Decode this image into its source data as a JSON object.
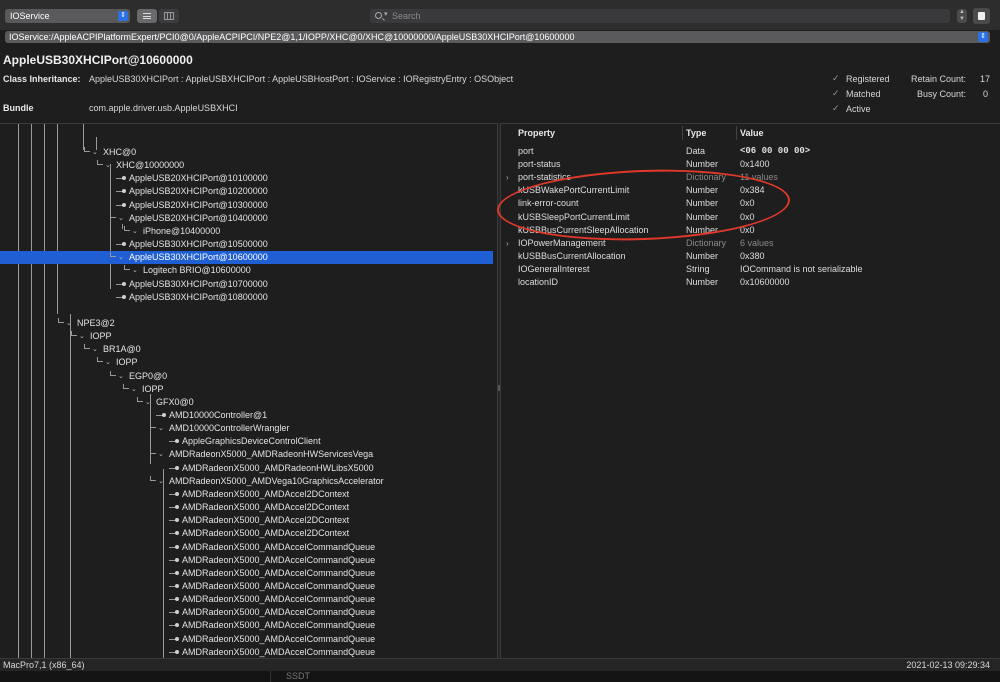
{
  "toolbar": {
    "plane": "IOService",
    "search_placeholder": "Search"
  },
  "path": "IOService:/AppleACPIPlatformExpert/PCI0@0/AppleACPIPCI/NPE2@1,1/IOPP/XHC@0/XHC@10000000/AppleUSB30XHCIPort@10600000",
  "header": {
    "title": "AppleUSB30XHCIPort@10600000",
    "class_label": "Class Inheritance:",
    "class_value": "AppleUSB30XHCIPort : AppleUSBXHCIPort : AppleUSBHostPort : IOService : IORegistryEntry : OSObject",
    "bundle_label": "Bundle",
    "bundle_value": "com.apple.driver.usb.AppleUSBXHCI",
    "flags": [
      "Registered",
      "Matched",
      "Active"
    ],
    "retain_label": "Retain Count:",
    "retain_value": "17",
    "busy_label": "Busy Count:",
    "busy_value": "0"
  },
  "tree": [
    {
      "label": "XHC@0",
      "selected": false
    },
    {
      "label": "XHC@10000000",
      "selected": false
    },
    {
      "label": "AppleUSB20XHCIPort@10100000",
      "selected": false
    },
    {
      "label": "AppleUSB20XHCIPort@10200000",
      "selected": false
    },
    {
      "label": "AppleUSB20XHCIPort@10300000",
      "selected": false
    },
    {
      "label": "AppleUSB20XHCIPort@10400000",
      "selected": false
    },
    {
      "label": "iPhone@10400000",
      "selected": false
    },
    {
      "label": "AppleUSB30XHCIPort@10500000",
      "selected": false
    },
    {
      "label": "AppleUSB30XHCIPort@10600000",
      "selected": true
    },
    {
      "label": "Logitech BRIO@10600000",
      "selected": false
    },
    {
      "label": "AppleUSB30XHCIPort@10700000",
      "selected": false
    },
    {
      "label": "AppleUSB30XHCIPort@10800000",
      "selected": false
    },
    {
      "label": "",
      "selected": false
    },
    {
      "label": "NPE3@2",
      "selected": false
    },
    {
      "label": "IOPP",
      "selected": false
    },
    {
      "label": "BR1A@0",
      "selected": false
    },
    {
      "label": "IOPP",
      "selected": false
    },
    {
      "label": "EGP0@0",
      "selected": false
    },
    {
      "label": "IOPP",
      "selected": false
    },
    {
      "label": "GFX0@0",
      "selected": false
    },
    {
      "label": "AMD10000Controller@1",
      "selected": false
    },
    {
      "label": "AMD10000ControllerWrangler",
      "selected": false
    },
    {
      "label": "AppleGraphicsDeviceControlClient",
      "selected": false
    },
    {
      "label": "AMDRadeonX5000_AMDRadeonHWServicesVega",
      "selected": false
    },
    {
      "label": "AMDRadeonX5000_AMDRadeonHWLibsX5000",
      "selected": false
    },
    {
      "label": "AMDRadeonX5000_AMDVega10GraphicsAccelerator",
      "selected": false
    },
    {
      "label": "AMDRadeonX5000_AMDAccel2DContext",
      "selected": false
    },
    {
      "label": "AMDRadeonX5000_AMDAccel2DContext",
      "selected": false
    },
    {
      "label": "AMDRadeonX5000_AMDAccel2DContext",
      "selected": false
    },
    {
      "label": "AMDRadeonX5000_AMDAccel2DContext",
      "selected": false
    },
    {
      "label": "AMDRadeonX5000_AMDAccelCommandQueue",
      "selected": false
    },
    {
      "label": "AMDRadeonX5000_AMDAccelCommandQueue",
      "selected": false
    },
    {
      "label": "AMDRadeonX5000_AMDAccelCommandQueue",
      "selected": false
    },
    {
      "label": "AMDRadeonX5000_AMDAccelCommandQueue",
      "selected": false
    },
    {
      "label": "AMDRadeonX5000_AMDAccelCommandQueue",
      "selected": false
    },
    {
      "label": "AMDRadeonX5000_AMDAccelCommandQueue",
      "selected": false
    },
    {
      "label": "AMDRadeonX5000_AMDAccelCommandQueue",
      "selected": false
    },
    {
      "label": "AMDRadeonX5000_AMDAccelCommandQueue",
      "selected": false
    },
    {
      "label": "AMDRadeonX5000_AMDAccelCommandQueue",
      "selected": false
    },
    {
      "label": "AMDRadeonX5000_AMDAccelDevice",
      "selected": false
    }
  ],
  "props": {
    "headers": [
      "Property",
      "Type",
      "Value"
    ],
    "rows": [
      {
        "name": "port",
        "type": "Data",
        "value": "<06 00 00 00>",
        "mono": true,
        "expandable": false,
        "dim": false
      },
      {
        "name": "port-status",
        "type": "Number",
        "value": "0x1400",
        "mono": false,
        "expandable": false,
        "dim": false
      },
      {
        "name": "port-statistics",
        "type": "Dictionary",
        "value": "11 values",
        "mono": false,
        "expandable": true,
        "dim": true
      },
      {
        "name": "kUSBWakePortCurrentLimit",
        "type": "Number",
        "value": "0x384",
        "mono": false,
        "expandable": false,
        "dim": false
      },
      {
        "name": "link-error-count",
        "type": "Number",
        "value": "0x0",
        "mono": false,
        "expandable": false,
        "dim": false
      },
      {
        "name": "kUSBSleepPortCurrentLimit",
        "type": "Number",
        "value": "0x0",
        "mono": false,
        "expandable": false,
        "dim": false
      },
      {
        "name": "kUSBBusCurrentSleepAllocation",
        "type": "Number",
        "value": "0x0",
        "mono": false,
        "expandable": false,
        "dim": false
      },
      {
        "name": "IOPowerManagement",
        "type": "Dictionary",
        "value": "6 values",
        "mono": false,
        "expandable": true,
        "dim": true
      },
      {
        "name": "kUSBBusCurrentAllocation",
        "type": "Number",
        "value": "0x380",
        "mono": false,
        "expandable": false,
        "dim": false
      },
      {
        "name": "IOGeneralInterest",
        "type": "String",
        "value": "IOCommand is not serializable",
        "mono": false,
        "expandable": false,
        "dim": false
      },
      {
        "name": "locationID",
        "type": "Number",
        "value": "0x10600000",
        "mono": false,
        "expandable": false,
        "dim": false
      }
    ]
  },
  "status": {
    "machine": "MacPro7,1 (x86_64)",
    "timestamp": "2021-02-13 09:29:34"
  },
  "bottom_strip_label": "SSDT"
}
